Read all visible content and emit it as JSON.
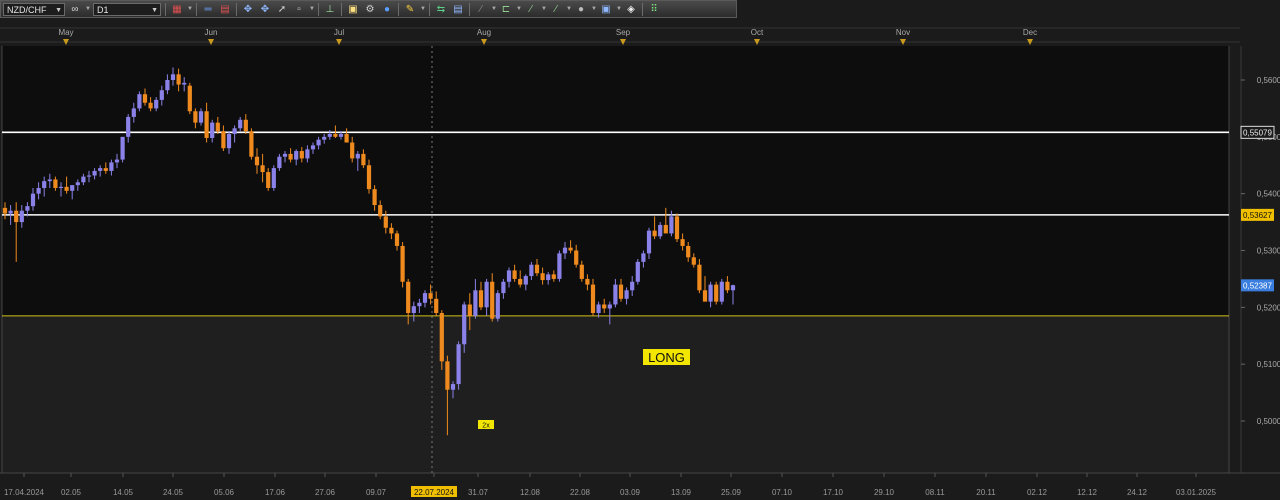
{
  "toolbar": {
    "symbol": "NZD/CHF",
    "timeframe": "D1",
    "icons": [
      "link-icon",
      "chart-type-icon",
      "crosshair-icon",
      "indicator-icon",
      "arrow-cursor-icon",
      "zoom-icon",
      "cursor-icon",
      "text-tool-icon",
      "pan-icon",
      "fibonacci-icon",
      "globe-icon",
      "pencil-icon",
      "trend-icon",
      "template-icon",
      "line-tool-icon",
      "channel-icon",
      "wave-icon",
      "shape-icon",
      "settings-icon",
      "eraser-icon",
      "grid-icon"
    ]
  },
  "chart_data": {
    "type": "candlestick",
    "symbol": "NZD/CHF",
    "timeframe": "D1",
    "ylim": [
      0.4945,
      0.5665
    ],
    "y_ticks": [
      "0,5600",
      "0,5500",
      "0,5400",
      "0,5300",
      "0,5200",
      "0,5100",
      "0,5000"
    ],
    "y_tick_values": [
      0.56,
      0.55,
      0.54,
      0.53,
      0.52,
      0.51,
      0.5
    ],
    "x_tick_labels": [
      "17.04.2024",
      "02.05",
      "14.05",
      "24.05",
      "05.06",
      "17.06",
      "27.06",
      "09.07",
      "22.07.2024",
      "31.07",
      "12.08",
      "22.08",
      "03.09",
      "13.09",
      "25.09",
      "07.10",
      "17.10",
      "29.10",
      "08.11",
      "20.11",
      "02.12",
      "12.12",
      "24.12",
      "03.01.2025"
    ],
    "x_tick_highlight": "22.07.2024",
    "months": [
      "May",
      "Jun",
      "Jul",
      "Aug",
      "Sep",
      "Oct",
      "Nov",
      "Dec"
    ],
    "horizontal_levels": [
      {
        "value": 0.55079,
        "label": "0,55079",
        "color": "#ffffff"
      },
      {
        "value": 0.53627,
        "label": "0,53627",
        "color": "#ffffff",
        "label_bg": "#f0c000"
      },
      {
        "value": 0.5185,
        "label": "",
        "color": "#d4c21a"
      }
    ],
    "current_price": {
      "value": 0.52387,
      "label": "0,52387",
      "color": "#3a7fe0"
    },
    "annotations": [
      {
        "text": "LONG",
        "color": "#f2e600"
      },
      {
        "text": "2x",
        "color": "#f2e600"
      }
    ],
    "bull_color": "#8a82e8",
    "bear_color": "#ef8a1e",
    "candles": [
      [
        0.5375,
        0.5385,
        0.5355,
        0.5365
      ],
      [
        0.5365,
        0.538,
        0.5345,
        0.537
      ],
      [
        0.537,
        0.5385,
        0.528,
        0.535
      ],
      [
        0.535,
        0.538,
        0.534,
        0.537
      ],
      [
        0.537,
        0.5385,
        0.536,
        0.5378
      ],
      [
        0.5378,
        0.541,
        0.537,
        0.54
      ],
      [
        0.54,
        0.542,
        0.539,
        0.541
      ],
      [
        0.541,
        0.543,
        0.5395,
        0.5422
      ],
      [
        0.5422,
        0.5435,
        0.541,
        0.5425
      ],
      [
        0.5425,
        0.543,
        0.5405,
        0.541
      ],
      [
        0.541,
        0.542,
        0.5395,
        0.5412
      ],
      [
        0.5412,
        0.543,
        0.54,
        0.5405
      ],
      [
        0.5405,
        0.5415,
        0.539,
        0.5415
      ],
      [
        0.5415,
        0.5425,
        0.5405,
        0.542
      ],
      [
        0.542,
        0.5435,
        0.5415,
        0.543
      ],
      [
        0.543,
        0.544,
        0.542,
        0.5432
      ],
      [
        0.5432,
        0.5445,
        0.5425,
        0.544
      ],
      [
        0.544,
        0.545,
        0.543,
        0.5445
      ],
      [
        0.5445,
        0.5455,
        0.5435,
        0.544
      ],
      [
        0.544,
        0.546,
        0.5432,
        0.5455
      ],
      [
        0.5455,
        0.547,
        0.5445,
        0.546
      ],
      [
        0.546,
        0.549,
        0.5455,
        0.55
      ],
      [
        0.55,
        0.554,
        0.549,
        0.5535
      ],
      [
        0.5535,
        0.556,
        0.5525,
        0.555
      ],
      [
        0.555,
        0.558,
        0.5545,
        0.5575
      ],
      [
        0.5575,
        0.5585,
        0.5555,
        0.556
      ],
      [
        0.556,
        0.557,
        0.5545,
        0.555
      ],
      [
        0.555,
        0.557,
        0.5545,
        0.5565
      ],
      [
        0.5565,
        0.559,
        0.5555,
        0.5582
      ],
      [
        0.5582,
        0.561,
        0.5575,
        0.56
      ],
      [
        0.56,
        0.5622,
        0.559,
        0.561
      ],
      [
        0.561,
        0.562,
        0.558,
        0.5592
      ],
      [
        0.5592,
        0.5605,
        0.558,
        0.5595
      ],
      [
        0.559,
        0.5595,
        0.554,
        0.5545
      ],
      [
        0.5545,
        0.555,
        0.5515,
        0.5525
      ],
      [
        0.5525,
        0.555,
        0.552,
        0.5545
      ],
      [
        0.5545,
        0.556,
        0.549,
        0.5498
      ],
      [
        0.5498,
        0.553,
        0.549,
        0.5525
      ],
      [
        0.5525,
        0.5535,
        0.5505,
        0.551
      ],
      [
        0.551,
        0.552,
        0.5475,
        0.548
      ],
      [
        0.548,
        0.551,
        0.547,
        0.5505
      ],
      [
        0.5505,
        0.552,
        0.549,
        0.5515
      ],
      [
        0.5515,
        0.5535,
        0.551,
        0.553
      ],
      [
        0.553,
        0.554,
        0.5505,
        0.551
      ],
      [
        0.551,
        0.5515,
        0.546,
        0.5465
      ],
      [
        0.5465,
        0.548,
        0.5435,
        0.545
      ],
      [
        0.545,
        0.547,
        0.542,
        0.5438
      ],
      [
        0.5438,
        0.5445,
        0.5405,
        0.541
      ],
      [
        0.541,
        0.545,
        0.5405,
        0.5445
      ],
      [
        0.5445,
        0.547,
        0.544,
        0.5465
      ],
      [
        0.5465,
        0.5475,
        0.5455,
        0.547
      ],
      [
        0.547,
        0.548,
        0.5455,
        0.546
      ],
      [
        0.546,
        0.5478,
        0.545,
        0.5475
      ],
      [
        0.5475,
        0.5482,
        0.5455,
        0.5462
      ],
      [
        0.5462,
        0.5485,
        0.5455,
        0.5478
      ],
      [
        0.5478,
        0.549,
        0.547,
        0.5485
      ],
      [
        0.5485,
        0.55,
        0.5478,
        0.5495
      ],
      [
        0.5495,
        0.5505,
        0.5488,
        0.55
      ],
      [
        0.55,
        0.5512,
        0.5495,
        0.5505
      ],
      [
        0.5505,
        0.552,
        0.5498,
        0.55
      ],
      [
        0.55,
        0.551,
        0.5495,
        0.5505
      ],
      [
        0.5505,
        0.5515,
        0.549,
        0.549
      ],
      [
        0.549,
        0.55,
        0.5455,
        0.5462
      ],
      [
        0.5462,
        0.5475,
        0.544,
        0.547
      ],
      [
        0.547,
        0.5478,
        0.5445,
        0.545
      ],
      [
        0.545,
        0.546,
        0.54,
        0.5408
      ],
      [
        0.5408,
        0.5415,
        0.537,
        0.538
      ],
      [
        0.538,
        0.5388,
        0.5355,
        0.536
      ],
      [
        0.536,
        0.537,
        0.533,
        0.534
      ],
      [
        0.534,
        0.5348,
        0.532,
        0.533
      ],
      [
        0.533,
        0.5335,
        0.53,
        0.5308
      ],
      [
        0.5308,
        0.5315,
        0.5235,
        0.5245
      ],
      [
        0.5245,
        0.525,
        0.517,
        0.519
      ],
      [
        0.519,
        0.521,
        0.5175,
        0.5202
      ],
      [
        0.5202,
        0.5215,
        0.519,
        0.5208
      ],
      [
        0.5208,
        0.523,
        0.52,
        0.5225
      ],
      [
        0.5225,
        0.524,
        0.5205,
        0.5215
      ],
      [
        0.5215,
        0.5228,
        0.5185,
        0.519
      ],
      [
        0.519,
        0.5195,
        0.509,
        0.5105
      ],
      [
        0.5105,
        0.5115,
        0.4975,
        0.5055
      ],
      [
        0.5055,
        0.507,
        0.504,
        0.5065
      ],
      [
        0.5065,
        0.514,
        0.5055,
        0.5135
      ],
      [
        0.5135,
        0.521,
        0.512,
        0.5205
      ],
      [
        0.5205,
        0.5225,
        0.516,
        0.5185
      ],
      [
        0.5185,
        0.525,
        0.518,
        0.523
      ],
      [
        0.523,
        0.5245,
        0.5195,
        0.52
      ],
      [
        0.52,
        0.525,
        0.5185,
        0.5245
      ],
      [
        0.5245,
        0.526,
        0.5175,
        0.518
      ],
      [
        0.518,
        0.523,
        0.5175,
        0.5225
      ],
      [
        0.5225,
        0.525,
        0.5215,
        0.5245
      ],
      [
        0.5245,
        0.527,
        0.5235,
        0.5265
      ],
      [
        0.5265,
        0.5275,
        0.5245,
        0.525
      ],
      [
        0.525,
        0.5265,
        0.5235,
        0.524
      ],
      [
        0.524,
        0.5258,
        0.523,
        0.5255
      ],
      [
        0.5255,
        0.528,
        0.5248,
        0.5275
      ],
      [
        0.5275,
        0.5285,
        0.5255,
        0.526
      ],
      [
        0.526,
        0.527,
        0.524,
        0.5248
      ],
      [
        0.5248,
        0.5262,
        0.524,
        0.5258
      ],
      [
        0.5258,
        0.5265,
        0.5245,
        0.525
      ],
      [
        0.525,
        0.53,
        0.5245,
        0.5295
      ],
      [
        0.5295,
        0.5315,
        0.5285,
        0.5305
      ],
      [
        0.5305,
        0.5318,
        0.5295,
        0.53
      ],
      [
        0.53,
        0.531,
        0.527,
        0.5275
      ],
      [
        0.5275,
        0.5282,
        0.5245,
        0.525
      ],
      [
        0.525,
        0.5258,
        0.523,
        0.524
      ],
      [
        0.524,
        0.525,
        0.5185,
        0.519
      ],
      [
        0.519,
        0.521,
        0.5182,
        0.5205
      ],
      [
        0.5205,
        0.5215,
        0.519,
        0.5198
      ],
      [
        0.5198,
        0.521,
        0.517,
        0.5205
      ],
      [
        0.5205,
        0.525,
        0.52,
        0.524
      ],
      [
        0.524,
        0.525,
        0.521,
        0.5215
      ],
      [
        0.5215,
        0.5235,
        0.5205,
        0.523
      ],
      [
        0.523,
        0.5255,
        0.522,
        0.5245
      ],
      [
        0.5245,
        0.5285,
        0.524,
        0.528
      ],
      [
        0.528,
        0.53,
        0.527,
        0.5295
      ],
      [
        0.5295,
        0.534,
        0.5285,
        0.5335
      ],
      [
        0.5335,
        0.536,
        0.532,
        0.5325
      ],
      [
        0.5325,
        0.535,
        0.532,
        0.5345
      ],
      [
        0.5345,
        0.5375,
        0.5335,
        0.533
      ],
      [
        0.533,
        0.537,
        0.5325,
        0.536
      ],
      [
        0.536,
        0.5365,
        0.5315,
        0.532
      ],
      [
        0.532,
        0.533,
        0.53,
        0.5308
      ],
      [
        0.5308,
        0.5315,
        0.528,
        0.5288
      ],
      [
        0.5288,
        0.5295,
        0.527,
        0.5275
      ],
      [
        0.5275,
        0.5285,
        0.5225,
        0.523
      ],
      [
        0.523,
        0.5255,
        0.5215,
        0.521
      ],
      [
        0.521,
        0.5245,
        0.52,
        0.524
      ],
      [
        0.524,
        0.5245,
        0.5205,
        0.521
      ],
      [
        0.521,
        0.525,
        0.5205,
        0.5245
      ],
      [
        0.5245,
        0.5255,
        0.5225,
        0.523
      ],
      [
        0.523,
        0.524,
        0.5205,
        0.5239
      ]
    ]
  }
}
